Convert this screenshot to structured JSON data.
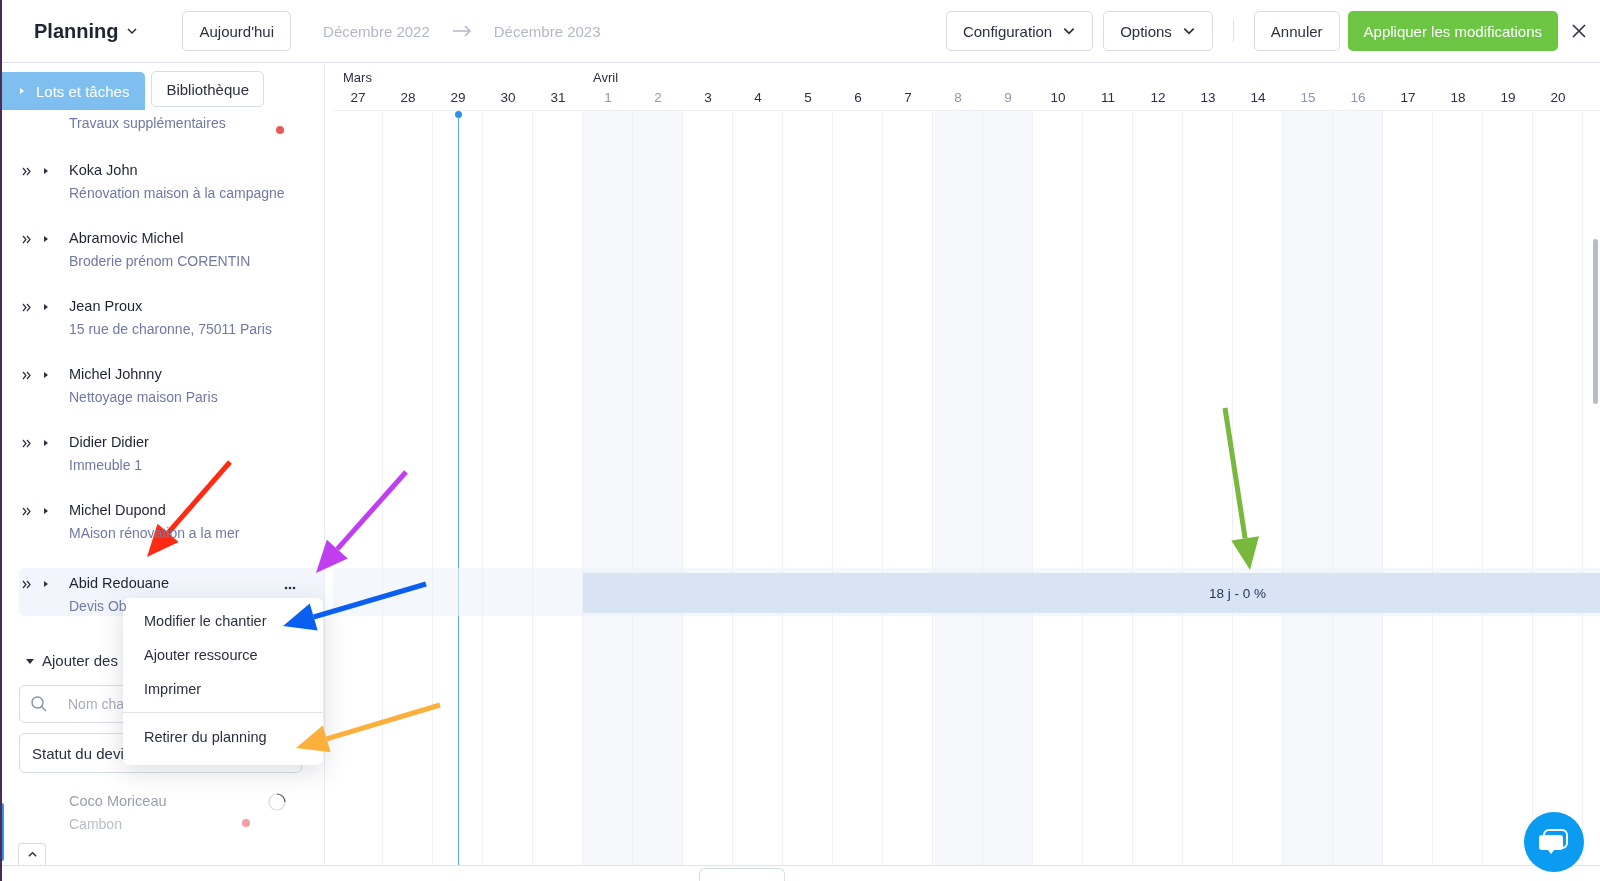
{
  "header": {
    "title": "Planning",
    "today_button": "Aujourd'hui",
    "date_from": "Décembre 2022",
    "date_to": "Décembre 2023",
    "menus": [
      {
        "label": "Configuration"
      },
      {
        "label": "Options"
      }
    ],
    "cancel_button": "Annuler",
    "apply_button": "Appliquer les modifications"
  },
  "tabs": [
    {
      "label": "Lots et tâches",
      "selected": true
    },
    {
      "label": "Bibliothèque",
      "selected": false
    }
  ],
  "projects": [
    {
      "subtitle": "Travaux supplémentaires",
      "highlighted": false,
      "color": "#e85a5a"
    },
    {
      "name": "Koka John",
      "subtitle": "Rénovation maison à la campagne",
      "highlighted": false
    },
    {
      "name": "Abramovic Michel",
      "subtitle": "Broderie prénom CORENTIN",
      "highlighted": false
    },
    {
      "name": "Jean Proux",
      "subtitle": "15 rue de charonne, 75011 Paris",
      "highlighted": false
    },
    {
      "name": "Michel Johnny",
      "subtitle": "Nettoyage maison Paris",
      "highlighted": false
    },
    {
      "name": "Didier Didier",
      "subtitle": "Immeuble 1",
      "highlighted": false
    },
    {
      "name": "Michel Dupond",
      "subtitle": "MAison rénovation a la mer",
      "highlighted": false
    },
    {
      "name": "Abid Redouane",
      "subtitle": "Devis Ob",
      "highlighted": true,
      "bar_label": "18 j - 0 %"
    }
  ],
  "context_menu": [
    {
      "label": "Modifier le chantier",
      "separated": false
    },
    {
      "label": "Ajouter ressource",
      "separated": false
    },
    {
      "label": "Imprimer",
      "separated": false
    },
    {
      "label": "Retirer du planning",
      "separated": true
    }
  ],
  "add_section": {
    "label": "Ajouter des",
    "expanded": true,
    "search_placeholder": "Nom cha",
    "status_select": "Statut du devi"
  },
  "unplanned": [
    {
      "name": "Coco Moriceau",
      "subtitle": "Cambon",
      "color": "#f2a0a8"
    }
  ],
  "timeline": {
    "days": [
      {
        "label": "27",
        "month": "Mars",
        "weekend": false,
        "today": false
      },
      {
        "label": "28",
        "weekend": false,
        "today": false
      },
      {
        "label": "29",
        "weekend": false,
        "today": true
      },
      {
        "label": "30",
        "weekend": false,
        "today": false
      },
      {
        "label": "31",
        "weekend": false,
        "today": false
      },
      {
        "label": "1",
        "month": "Avril",
        "weekend": true,
        "today": false
      },
      {
        "label": "2",
        "weekend": true,
        "today": false
      },
      {
        "label": "3",
        "weekend": false,
        "today": false
      },
      {
        "label": "4",
        "weekend": false,
        "today": false
      },
      {
        "label": "5",
        "weekend": false,
        "today": false
      },
      {
        "label": "6",
        "weekend": false,
        "today": false
      },
      {
        "label": "7",
        "weekend": false,
        "today": false
      },
      {
        "label": "8",
        "weekend": true,
        "today": false
      },
      {
        "label": "9",
        "weekend": true,
        "today": false
      },
      {
        "label": "10",
        "weekend": false,
        "today": false
      },
      {
        "label": "11",
        "weekend": false,
        "today": false
      },
      {
        "label": "12",
        "weekend": false,
        "today": false
      },
      {
        "label": "13",
        "weekend": false,
        "today": false
      },
      {
        "label": "14",
        "weekend": false,
        "today": false
      },
      {
        "label": "15",
        "weekend": true,
        "today": false
      },
      {
        "label": "16",
        "weekend": true,
        "today": false
      },
      {
        "label": "17",
        "weekend": false,
        "today": false
      },
      {
        "label": "18",
        "weekend": false,
        "today": false
      },
      {
        "label": "19",
        "weekend": false,
        "today": false
      },
      {
        "label": "20",
        "weekend": false,
        "today": false
      }
    ]
  },
  "annotations": [
    {
      "color": "#ff2a12"
    },
    {
      "color": "#c03ef0"
    },
    {
      "color": "#0a5ff0"
    },
    {
      "color": "#fbb03b"
    },
    {
      "color": "#78b83c"
    }
  ]
}
